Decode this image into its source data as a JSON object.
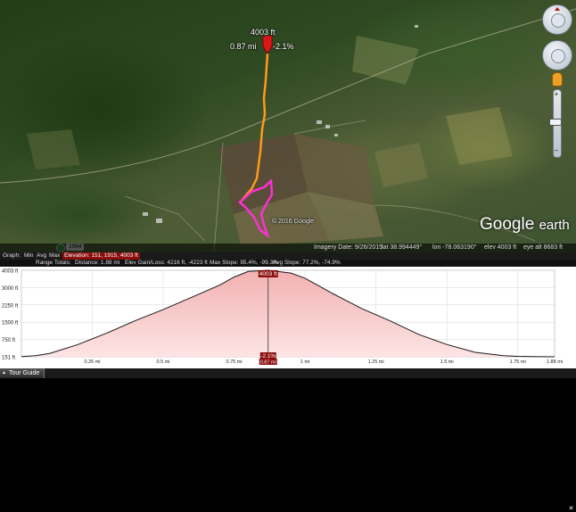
{
  "map": {
    "marker": {
      "elevation": "4003 ft",
      "distance": "0.87 mi",
      "grade": "-2.1%"
    },
    "copyright": "© 2016 Google",
    "badge": "1994",
    "logo": {
      "google": "Google",
      "earth": "earth"
    },
    "status": {
      "imagery_date": "Imagery Date: 9/26/2015",
      "lat": "lat   38.994449°",
      "lon": "lon  -78.063190°",
      "elev": "elev  4003 ft",
      "eye_alt": "eye alt  8683 ft"
    }
  },
  "graph_bar": {
    "graph": "Graph:",
    "min": "Min",
    "avg": "Avg",
    "max": "Max",
    "elevation": "Elevation: 151, 1915, 4003 ft"
  },
  "range_bar": {
    "range_totals": "Range Totals:",
    "distance": "Distance: 1.88 mi",
    "elev_gain": "Elev Gain/Loss: 4216 ft, -4223 ft",
    "max_slope": "Max Slope: 95.4%, -99.3%",
    "avg_slope": "Avg Slope: 77.2%, -74.9%"
  },
  "profile": {
    "cursor_elevation": "4003 ft",
    "cursor_grade": "-2.1%",
    "cursor_distance": "0.87 mi",
    "y_ticks": [
      "4003 ft",
      "3000 ft",
      "2250 ft",
      "1500 ft",
      "750 ft",
      "151 ft"
    ],
    "x_ticks": [
      "0.25 mi",
      "0.5 mi",
      "0.75 mi",
      "1 mi",
      "1.25 mi",
      "1.5 mi",
      "1.75 mi",
      "1.88 mi"
    ]
  },
  "chart_data": {
    "type": "area",
    "x_unit": "mi",
    "y_unit": "ft",
    "x": [
      0,
      0.05,
      0.1,
      0.2,
      0.3,
      0.4,
      0.5,
      0.6,
      0.7,
      0.75,
      0.8,
      0.87,
      0.95,
      1.0,
      1.05,
      1.1,
      1.2,
      1.3,
      1.4,
      1.5,
      1.6,
      1.7,
      1.75,
      1.8,
      1.88
    ],
    "y": [
      160,
      200,
      300,
      700,
      1200,
      1750,
      2250,
      2800,
      3350,
      3700,
      3950,
      4003,
      3880,
      3650,
      3300,
      2950,
      2300,
      1750,
      1150,
      700,
      350,
      200,
      170,
      160,
      151
    ],
    "xlim": [
      0,
      1.88
    ],
    "ylim": [
      151,
      4003
    ],
    "grid": true
  },
  "taskbar": {
    "tour_guide": "Tour Guide"
  }
}
